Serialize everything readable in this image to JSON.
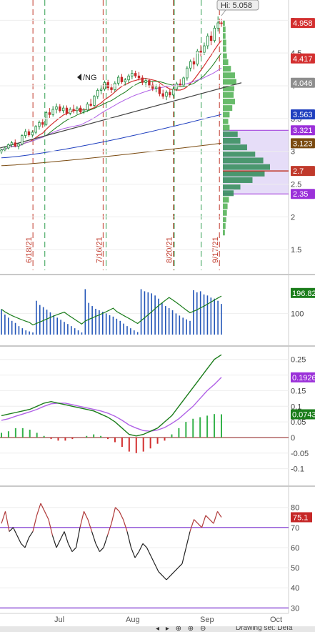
{
  "chart_data": [
    {
      "type": "candlestick",
      "symbol": "/NG",
      "high_label": "Hi: 5.058",
      "x_ticks": [
        "Jul",
        "Aug",
        "Sep",
        "Oct"
      ],
      "ylim": [
        1.25,
        5.2
      ],
      "y_ticks": [
        "5",
        "4.5",
        "4",
        "3.5",
        "3",
        "2.5",
        "2",
        "1.5"
      ],
      "vertical_date_labels": [
        "6/18/21",
        "7/16/21",
        "8/20/21",
        "9/17/21"
      ],
      "price_badges": [
        {
          "label": "4.958",
          "value": 4.958,
          "color": "#d32f2f"
        },
        {
          "label": "4.417",
          "value": 4.417,
          "color": "#d32f2f"
        },
        {
          "label": "4.046",
          "value": 4.046,
          "color": "#8e8e8e"
        },
        {
          "label": "3.563",
          "value": 3.563,
          "color": "#1f3fbf"
        },
        {
          "label": "3.321",
          "value": 3.321,
          "color": "#9b30d9"
        },
        {
          "label": "3.123",
          "value": 3.123,
          "color": "#7a4a10"
        },
        {
          "label": "2.7",
          "value": 2.7,
          "color": "#c0392b"
        },
        {
          "label": "2.35",
          "value": 2.35,
          "color": "#9b30d9"
        }
      ],
      "candles": [
        [
          2.99,
          3.04,
          2.96,
          3.02
        ],
        [
          3.02,
          3.07,
          2.99,
          3.05
        ],
        [
          3.05,
          3.12,
          3.03,
          3.1
        ],
        [
          3.1,
          3.16,
          3.06,
          3.13
        ],
        [
          3.13,
          3.18,
          3.06,
          3.08
        ],
        [
          3.08,
          3.13,
          3.03,
          3.11
        ],
        [
          3.11,
          3.26,
          3.09,
          3.24
        ],
        [
          3.24,
          3.34,
          3.2,
          3.3
        ],
        [
          3.3,
          3.34,
          3.22,
          3.25
        ],
        [
          3.25,
          3.32,
          3.21,
          3.29
        ],
        [
          3.29,
          3.4,
          3.26,
          3.38
        ],
        [
          3.38,
          3.47,
          3.33,
          3.44
        ],
        [
          3.44,
          3.49,
          3.36,
          3.41
        ],
        [
          3.41,
          3.62,
          3.39,
          3.59
        ],
        [
          3.59,
          3.66,
          3.51,
          3.56
        ],
        [
          3.56,
          3.69,
          3.53,
          3.64
        ],
        [
          3.64,
          3.73,
          3.58,
          3.68
        ],
        [
          3.68,
          3.72,
          3.59,
          3.62
        ],
        [
          3.62,
          3.7,
          3.58,
          3.66
        ],
        [
          3.66,
          3.7,
          3.55,
          3.58
        ],
        [
          3.58,
          3.67,
          3.55,
          3.64
        ],
        [
          3.64,
          3.71,
          3.58,
          3.62
        ],
        [
          3.62,
          3.69,
          3.57,
          3.66
        ],
        [
          3.66,
          3.7,
          3.57,
          3.6
        ],
        [
          3.6,
          3.66,
          3.57,
          3.63
        ],
        [
          3.63,
          3.75,
          3.6,
          3.72
        ],
        [
          3.72,
          3.8,
          3.68,
          3.7
        ],
        [
          3.7,
          3.86,
          3.68,
          3.84
        ],
        [
          3.84,
          3.96,
          3.8,
          3.93
        ],
        [
          3.93,
          4.01,
          3.87,
          3.95
        ],
        [
          3.95,
          4.08,
          3.92,
          4.05
        ],
        [
          4.05,
          4.09,
          3.93,
          3.97
        ],
        [
          3.97,
          4.02,
          3.89,
          3.94
        ],
        [
          3.94,
          4.07,
          3.91,
          4.04
        ],
        [
          4.04,
          4.16,
          4.0,
          4.13
        ],
        [
          4.13,
          4.18,
          4.03,
          4.06
        ],
        [
          4.06,
          4.12,
          4.0,
          4.09
        ],
        [
          4.09,
          4.18,
          4.04,
          4.15
        ],
        [
          4.15,
          4.24,
          4.1,
          4.19
        ],
        [
          4.19,
          4.23,
          4.12,
          4.15
        ],
        [
          4.15,
          4.21,
          4.08,
          4.12
        ],
        [
          4.12,
          4.16,
          4.01,
          4.05
        ],
        [
          4.05,
          4.12,
          3.98,
          4.08
        ],
        [
          4.08,
          4.11,
          3.97,
          4.01
        ],
        [
          4.01,
          4.06,
          3.92,
          3.96
        ],
        [
          3.96,
          4.02,
          3.9,
          3.98
        ],
        [
          3.98,
          4.02,
          3.84,
          3.88
        ],
        [
          3.88,
          3.94,
          3.8,
          3.84
        ],
        [
          3.84,
          3.93,
          3.78,
          3.9
        ],
        [
          3.9,
          3.96,
          3.82,
          3.86
        ],
        [
          3.86,
          3.98,
          3.84,
          3.95
        ],
        [
          3.95,
          4.06,
          3.92,
          4.03
        ],
        [
          4.03,
          4.1,
          3.98,
          4.01
        ],
        [
          4.01,
          4.14,
          3.98,
          4.12
        ],
        [
          4.12,
          4.3,
          4.08,
          4.27
        ],
        [
          4.27,
          4.4,
          4.22,
          4.37
        ],
        [
          4.37,
          4.43,
          4.25,
          4.33
        ],
        [
          4.33,
          4.56,
          4.3,
          4.53
        ],
        [
          4.53,
          4.62,
          4.45,
          4.51
        ],
        [
          4.51,
          4.66,
          4.47,
          4.61
        ],
        [
          4.61,
          4.8,
          4.56,
          4.76
        ],
        [
          4.76,
          4.83,
          4.62,
          4.69
        ],
        [
          4.69,
          4.92,
          4.66,
          4.88
        ],
        [
          4.88,
          5.058,
          4.83,
          4.96
        ],
        [
          4.96,
          5.02,
          4.9,
          4.958
        ]
      ],
      "volume_profile": [
        {
          "price": 4.96,
          "v": 3
        },
        {
          "price": 4.86,
          "v": 4
        },
        {
          "price": 4.76,
          "v": 4
        },
        {
          "price": 4.66,
          "v": 5
        },
        {
          "price": 4.56,
          "v": 5
        },
        {
          "price": 4.46,
          "v": 6
        },
        {
          "price": 4.36,
          "v": 8
        },
        {
          "price": 4.26,
          "v": 12
        },
        {
          "price": 4.16,
          "v": 18
        },
        {
          "price": 4.06,
          "v": 20
        },
        {
          "price": 3.96,
          "v": 17
        },
        {
          "price": 3.86,
          "v": 16
        },
        {
          "price": 3.76,
          "v": 18
        },
        {
          "price": 3.66,
          "v": 14
        },
        {
          "price": 3.56,
          "v": 10
        },
        {
          "price": 3.46,
          "v": 8
        },
        {
          "price": 3.36,
          "v": 10
        },
        {
          "price": 3.26,
          "v": 22
        },
        {
          "price": 3.16,
          "v": 26
        },
        {
          "price": 3.06,
          "v": 36
        },
        {
          "price": 2.96,
          "v": 48
        },
        {
          "price": 2.86,
          "v": 60
        },
        {
          "price": 2.76,
          "v": 70
        },
        {
          "price": 2.66,
          "v": 62
        },
        {
          "price": 2.56,
          "v": 44
        },
        {
          "price": 2.46,
          "v": 26
        },
        {
          "price": 2.36,
          "v": 16
        },
        {
          "price": 2.26,
          "v": 9
        },
        {
          "price": 2.16,
          "v": 7
        },
        {
          "price": 2.06,
          "v": 6
        },
        {
          "price": 1.96,
          "v": 5
        },
        {
          "price": 1.86,
          "v": 4
        },
        {
          "price": 1.76,
          "v": 3
        }
      ],
      "value_area": [
        2.35,
        3.321
      ]
    },
    {
      "type": "bar",
      "y_ticks": [
        "100"
      ],
      "current_label": "196.82",
      "ylim": [
        0,
        230
      ],
      "values": [
        120,
        95,
        80,
        65,
        55,
        40,
        30,
        20,
        15,
        10,
        160,
        140,
        130,
        118,
        105,
        92,
        80,
        70,
        60,
        50,
        40,
        30,
        20,
        10,
        215,
        150,
        135,
        122,
        115,
        108,
        100,
        92,
        85,
        75,
        65,
        52,
        40,
        30,
        20,
        12,
        215,
        205,
        200,
        195,
        185,
        170,
        150,
        135,
        125,
        115,
        100,
        90,
        80,
        72,
        65,
        210,
        200,
        205,
        190,
        185,
        175,
        170,
        160,
        145
      ]
    },
    {
      "type": "line",
      "y_ticks": [
        "0.25",
        "0.2",
        "0.15",
        "0.1",
        "0.05",
        "0",
        "-0.05",
        "-0.1"
      ],
      "labels": [
        {
          "label": "0.1926",
          "value": 0.1926,
          "color": "#9b30d9"
        },
        {
          "label": "0.0743",
          "value": 0.0743,
          "color": "#1b7d1b"
        }
      ],
      "ylim": [
        -0.11,
        0.27
      ],
      "macd": [
        0.07,
        0.075,
        0.08,
        0.085,
        0.09,
        0.1,
        0.11,
        0.115,
        0.11,
        0.105,
        0.1,
        0.095,
        0.09,
        0.085,
        0.075,
        0.065,
        0.05,
        0.03,
        0.01,
        0.005,
        0.01,
        0.02,
        0.03,
        0.05,
        0.07,
        0.1,
        0.13,
        0.16,
        0.19,
        0.22,
        0.25,
        0.265
      ],
      "signal": [
        0.055,
        0.06,
        0.068,
        0.075,
        0.082,
        0.09,
        0.1,
        0.108,
        0.11,
        0.11,
        0.105,
        0.1,
        0.095,
        0.09,
        0.085,
        0.078,
        0.068,
        0.055,
        0.04,
        0.03,
        0.022,
        0.02,
        0.024,
        0.032,
        0.045,
        0.06,
        0.08,
        0.1,
        0.125,
        0.15,
        0.17,
        0.1926
      ],
      "histogram": [
        0.015,
        0.02,
        0.03,
        0.03,
        0.025,
        0.015,
        0.005,
        -0.005,
        -0.01,
        -0.01,
        -0.005,
        0.0,
        0.005,
        0.01,
        0.005,
        -0.005,
        -0.015,
        -0.03,
        -0.045,
        -0.05,
        -0.045,
        -0.035,
        -0.02,
        -0.01,
        0.01,
        0.03,
        0.05,
        0.06,
        0.065,
        0.07,
        0.075,
        0.0743
      ]
    },
    {
      "type": "line",
      "y_ticks": [
        "80",
        "70",
        "60",
        "50",
        "40",
        "30"
      ],
      "current_label": "75.1",
      "overbought": 70,
      "ylim": [
        28,
        87
      ],
      "values": [
        72,
        78,
        68,
        70,
        66,
        62,
        60,
        65,
        68,
        76,
        82,
        78,
        74,
        66,
        60,
        64,
        68,
        62,
        58,
        60,
        70,
        78,
        74,
        68,
        62,
        58,
        60,
        66,
        72,
        80,
        78,
        74,
        68,
        60,
        55,
        58,
        62,
        60,
        56,
        52,
        48,
        46,
        44,
        46,
        48,
        50,
        52,
        60,
        68,
        74,
        72,
        70,
        76,
        74,
        72,
        78,
        75.1
      ]
    }
  ]
}
